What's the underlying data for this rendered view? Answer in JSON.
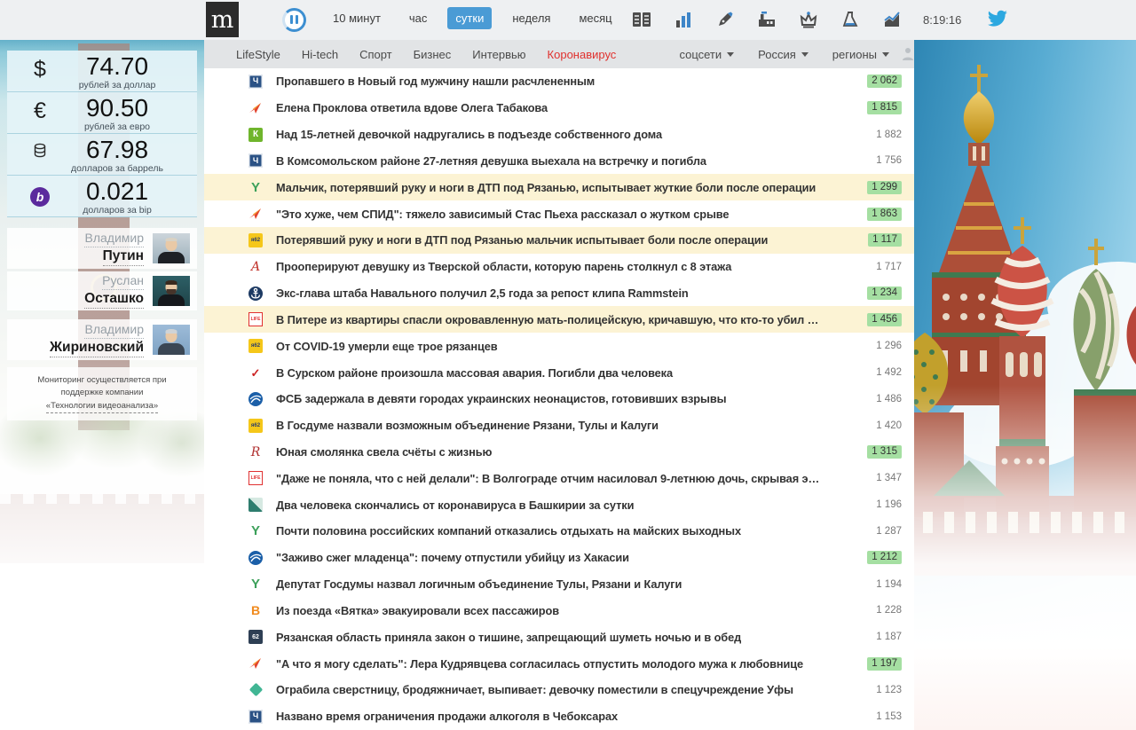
{
  "header": {
    "logo_text": "m",
    "time_filters": [
      "10 минут",
      "час",
      "сутки",
      "неделя",
      "месяц"
    ],
    "selected_filter": "сутки",
    "toolbar_icons": [
      "columns-icon",
      "bar-chart-icon",
      "pen-icon",
      "factory-icon",
      "crown-icon",
      "flask-icon",
      "trend-icon"
    ],
    "clock": "8:19:16",
    "twitter_color": "#2ca8e0"
  },
  "categories": {
    "items": [
      {
        "label": "LifeStyle",
        "accent": false
      },
      {
        "label": "Hi-tech",
        "accent": false
      },
      {
        "label": "Спорт",
        "accent": false
      },
      {
        "label": "Бизнес",
        "accent": false
      },
      {
        "label": "Интервью",
        "accent": false
      },
      {
        "label": "Коронавирус",
        "accent": true
      }
    ],
    "dropdowns": [
      "соцсети",
      "Россия",
      "регионы"
    ]
  },
  "rates": [
    {
      "icon": "dollar",
      "symbol": "$",
      "value": "74.70",
      "caption": "рублей за доллар"
    },
    {
      "icon": "euro",
      "symbol": "€",
      "value": "90.50",
      "caption": "рублей за евро"
    },
    {
      "icon": "barrel",
      "symbol": "",
      "value": "67.98",
      "caption": "долларов за баррель"
    },
    {
      "icon": "bip",
      "symbol": "b",
      "value": "0.021",
      "caption": "долларов за bip"
    }
  ],
  "people": [
    {
      "first": "Владимир",
      "last": "Путин"
    },
    {
      "first": "Руслан",
      "last": "Осташко"
    },
    {
      "first": "Владимир",
      "last": "Жириновский"
    }
  ],
  "sidebar_footer": {
    "text": "Мониторинг осуществляется при поддержке компании",
    "link": "«Технологии видеоанализа»"
  },
  "colors": {
    "accent_blue": "#4a9bd5",
    "accent_red": "#e0312e",
    "badge_green": "#a5dfa2",
    "highlight_yellow": "#fcf3d4"
  },
  "source_icons": {
    "ch": {
      "style": "square",
      "bg": "#2b5285",
      "fg": "#ffffff",
      "text": "Ч",
      "size": 9,
      "inset": true
    },
    "plane": {
      "style": "plane"
    },
    "k": {
      "style": "square",
      "bg": "#6fb52c",
      "fg": "#ffffff",
      "text": "К",
      "size": 10
    },
    "y": {
      "style": "letter",
      "fg": "#3ca05a",
      "text": "Y",
      "weight": "bold",
      "size": 15
    },
    "ya62": {
      "style": "square",
      "bg": "#f5c71a",
      "fg": "#2c3e6b",
      "text": "я62",
      "size": 6
    },
    "afanasy": {
      "style": "letter",
      "fg": "#c03028",
      "text": "A",
      "italic": true,
      "serif": true,
      "size": 14
    },
    "anchor": {
      "style": "anchor",
      "bg": "#1d3a63"
    },
    "life": {
      "style": "life",
      "fg": "#e03131",
      "text": "LIFE"
    },
    "check": {
      "style": "letter",
      "fg": "#cc2222",
      "text": "✓",
      "weight": "bold",
      "size": 13
    },
    "globe": {
      "style": "globe",
      "bg": "#1b5fa8"
    },
    "rscript": {
      "style": "letter",
      "fg": "#b03030",
      "text": "R",
      "italic": true,
      "serif": true,
      "size": 14
    },
    "diag": {
      "style": "diag",
      "bg": "#2e7d6e"
    },
    "borange": {
      "style": "letter",
      "fg": "#f08a1d",
      "text": "B",
      "weight": "bold",
      "size": 14
    },
    "s62": {
      "style": "square",
      "bg": "#2e3f54",
      "fg": "#ffffff",
      "text": "62",
      "size": 7
    },
    "diamond": {
      "style": "diamond",
      "bg": "#41b694"
    }
  },
  "news": [
    {
      "icon": "ch",
      "title": "Пропавшего в Новый год мужчину нашли расчлененным",
      "count": "2 062",
      "badge": true,
      "highlight": false
    },
    {
      "icon": "plane",
      "title": "Елена Проклова ответила вдове Олега Табакова",
      "count": "1 815",
      "badge": true,
      "highlight": false
    },
    {
      "icon": "k",
      "title": "Над 15-летней девочкой надругались в подъезде собственного дома",
      "count": "1 882",
      "badge": false,
      "highlight": false
    },
    {
      "icon": "ch",
      "title": "В Комсомольском районе 27-летняя девушка выехала на встречку и погибла",
      "count": "1 756",
      "badge": false,
      "highlight": false
    },
    {
      "icon": "y",
      "title": "Мальчик, потерявший руку и ноги в ДТП под Рязанью, испытывает жуткие боли после операции",
      "count": "1 299",
      "badge": true,
      "highlight": true
    },
    {
      "icon": "plane",
      "title": "\"Это хуже, чем СПИД\": тяжело зависимый Стас Пьеха рассказал о жутком срыве",
      "count": "1 863",
      "badge": true,
      "highlight": false
    },
    {
      "icon": "ya62",
      "title": "Потерявший руку и ноги в ДТП под Рязанью мальчик испытывает боли после операции",
      "count": "1 117",
      "badge": true,
      "highlight": true
    },
    {
      "icon": "afanasy",
      "title": "Прооперируют девушку из Тверской области, которую парень столкнул с 8 этажа",
      "count": "1 717",
      "badge": false,
      "highlight": false
    },
    {
      "icon": "anchor",
      "title": "Экс-глава штаба Навального получил 2,5 года за репост клипа Rammstein",
      "count": "1 234",
      "badge": true,
      "highlight": false
    },
    {
      "icon": "life",
      "title": "В Питере из квартиры спасли окровавленную мать-полицейскую, кричавшую, что кто-то убил …",
      "count": "1 456",
      "badge": true,
      "highlight": true
    },
    {
      "icon": "ya62",
      "title": "От COVID-19 умерли еще трое рязанцев",
      "count": "1 296",
      "badge": false,
      "highlight": false
    },
    {
      "icon": "check",
      "title": "В Сурском районе произошла массовая авария. Погибли два человека",
      "count": "1 492",
      "badge": false,
      "highlight": false
    },
    {
      "icon": "globe",
      "title": "ФСБ задержала в девяти городах украинских неонацистов, готовивших взрывы",
      "count": "1 486",
      "badge": false,
      "highlight": false
    },
    {
      "icon": "ya62",
      "title": "В Госдуме назвали возможным объединение Рязани, Тулы и Калуги",
      "count": "1 420",
      "badge": false,
      "highlight": false
    },
    {
      "icon": "rscript",
      "title": "Юная смолянка свела счёты с жизнью",
      "count": "1 315",
      "badge": true,
      "highlight": false
    },
    {
      "icon": "life",
      "title": "\"Даже не поняла, что с ней делали\": В Волгограде отчим насиловал 9-летнюю дочь, скрывая э…",
      "count": "1 347",
      "badge": false,
      "highlight": false
    },
    {
      "icon": "diag",
      "title": "Два человека скончались от коронавируса в Башкирии за сутки",
      "count": "1 196",
      "badge": false,
      "highlight": false
    },
    {
      "icon": "y",
      "title": "Почти половина российских компаний отказались отдыхать на майских выходных",
      "count": "1 287",
      "badge": false,
      "highlight": false
    },
    {
      "icon": "globe",
      "title": "\"Заживо сжег младенца\": почему отпустили убийцу из Хакасии",
      "count": "1 212",
      "badge": true,
      "highlight": false
    },
    {
      "icon": "y",
      "title": "Депутат Госдумы назвал логичным объединение Тулы, Рязани и Калуги",
      "count": "1 194",
      "badge": false,
      "highlight": false
    },
    {
      "icon": "borange",
      "title": "Из поезда «Вятка» эвакуировали всех пассажиров",
      "count": "1 228",
      "badge": false,
      "highlight": false
    },
    {
      "icon": "s62",
      "title": "Рязанская область приняла закон о тишине, запрещающий шуметь ночью и в обед",
      "count": "1 187",
      "badge": false,
      "highlight": false
    },
    {
      "icon": "plane",
      "title": "\"А что я могу сделать\": Лера Кудрявцева согласилась отпустить молодого мужа к любовнице",
      "count": "1 197",
      "badge": true,
      "highlight": false
    },
    {
      "icon": "diamond",
      "title": "Ограбила сверстницу, бродяжничает, выпивает: девочку поместили в спецучреждение Уфы",
      "count": "1 123",
      "badge": false,
      "highlight": false
    },
    {
      "icon": "ch",
      "title": "Названо время ограничения продажи алкоголя в Чебоксарах",
      "count": "1 153",
      "badge": false,
      "highlight": false
    }
  ]
}
